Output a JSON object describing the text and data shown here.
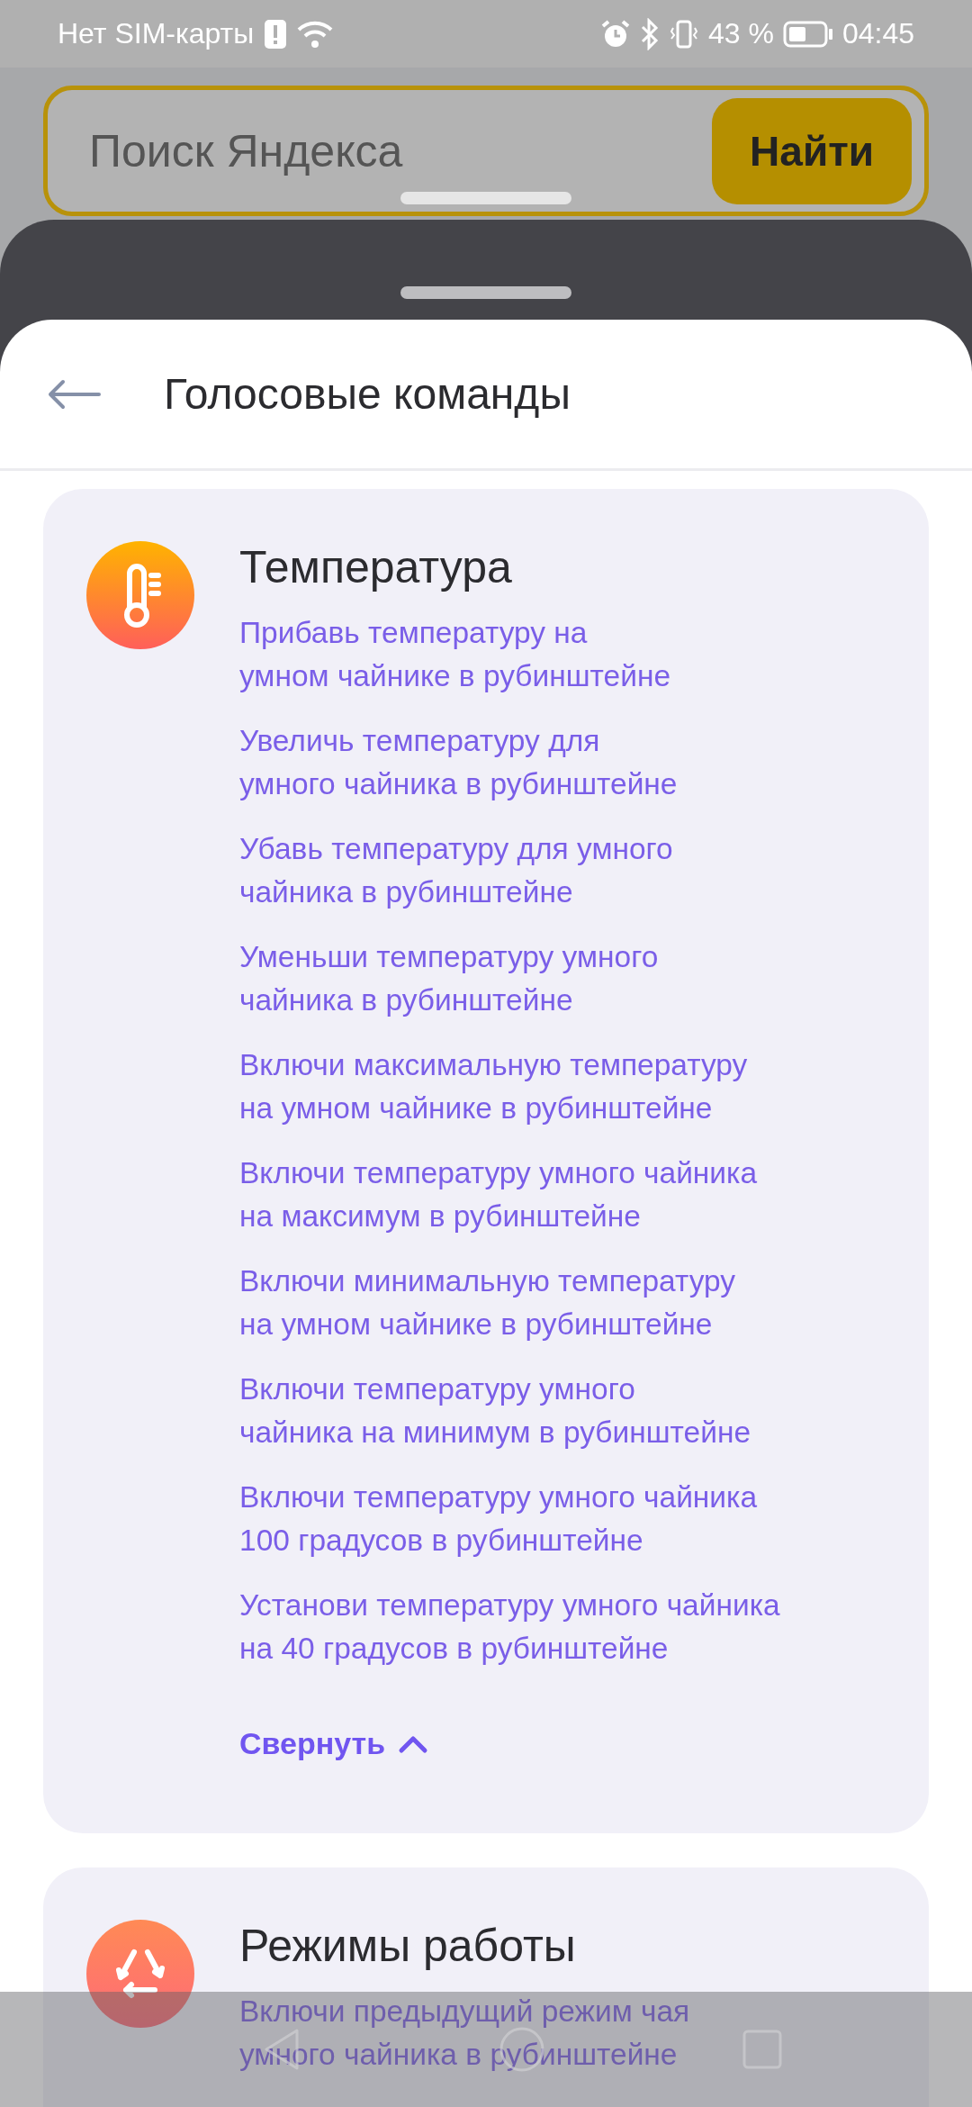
{
  "status_bar": {
    "carrier": "Нет SIM-карты",
    "battery": "43 %",
    "time": "04:45"
  },
  "search": {
    "placeholder": "Поиск Яндекса",
    "button": "Найти"
  },
  "header": {
    "title": "Голосовые команды"
  },
  "sections": [
    {
      "title": "Температура",
      "kind": "thermometer",
      "commands": [
        "Прибавь температуру на умном чайнике в рубинштейне",
        "Увеличь температуру для умного чайника в рубинштейне",
        "Убавь температуру для умного чайника в рубинштейне",
        "Уменьши температуру умного чайника в рубинштейне",
        "Включи максимальную температуру на умном чайнике в рубинштейне",
        "Включи температуру умного чайника на максимум в рубинштейне",
        "Включи минимальную температуру на умном чайнике в рубинштейне",
        "Включи температуру умного чайника на минимум в рубинштейне",
        "Включи температуру умного чайника 100 градусов в рубинштейне",
        "Установи температуру умного чайника на 40 градусов в рубинштейне"
      ],
      "collapse": "Свернуть"
    },
    {
      "title": "Режимы работы",
      "kind": "cycle",
      "commands": [
        "Включи предыдущий режим чая умного чайника в рубинштейне"
      ]
    }
  ]
}
